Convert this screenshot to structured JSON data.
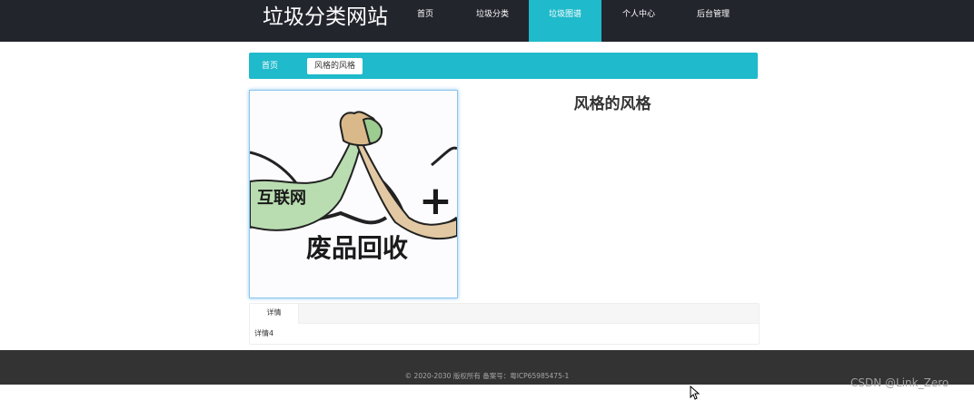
{
  "header": {
    "site_title": "垃圾分类网站",
    "nav": [
      {
        "label": "首页"
      },
      {
        "label": "垃圾分类"
      },
      {
        "label": "垃圾图谱",
        "active": true
      },
      {
        "label": "个人中心"
      },
      {
        "label": "后台管理"
      }
    ]
  },
  "breadcrumb": {
    "home": "首页",
    "current": "风格的风格"
  },
  "detail": {
    "title": "风格的风格",
    "image_text": {
      "line1": "互联网",
      "plus": "+",
      "line2": "废品回收"
    }
  },
  "tabs": {
    "items": [
      {
        "label": "详情"
      }
    ],
    "content": "详情4"
  },
  "footer": {
    "copyright": "© 2020-2030 版权所有 备案号：粤ICP65985475-1"
  },
  "watermark": "CSDN @Link_Zero",
  "colors": {
    "topbar": "#23252d",
    "accent": "#1fbacb",
    "footer": "#333333"
  }
}
